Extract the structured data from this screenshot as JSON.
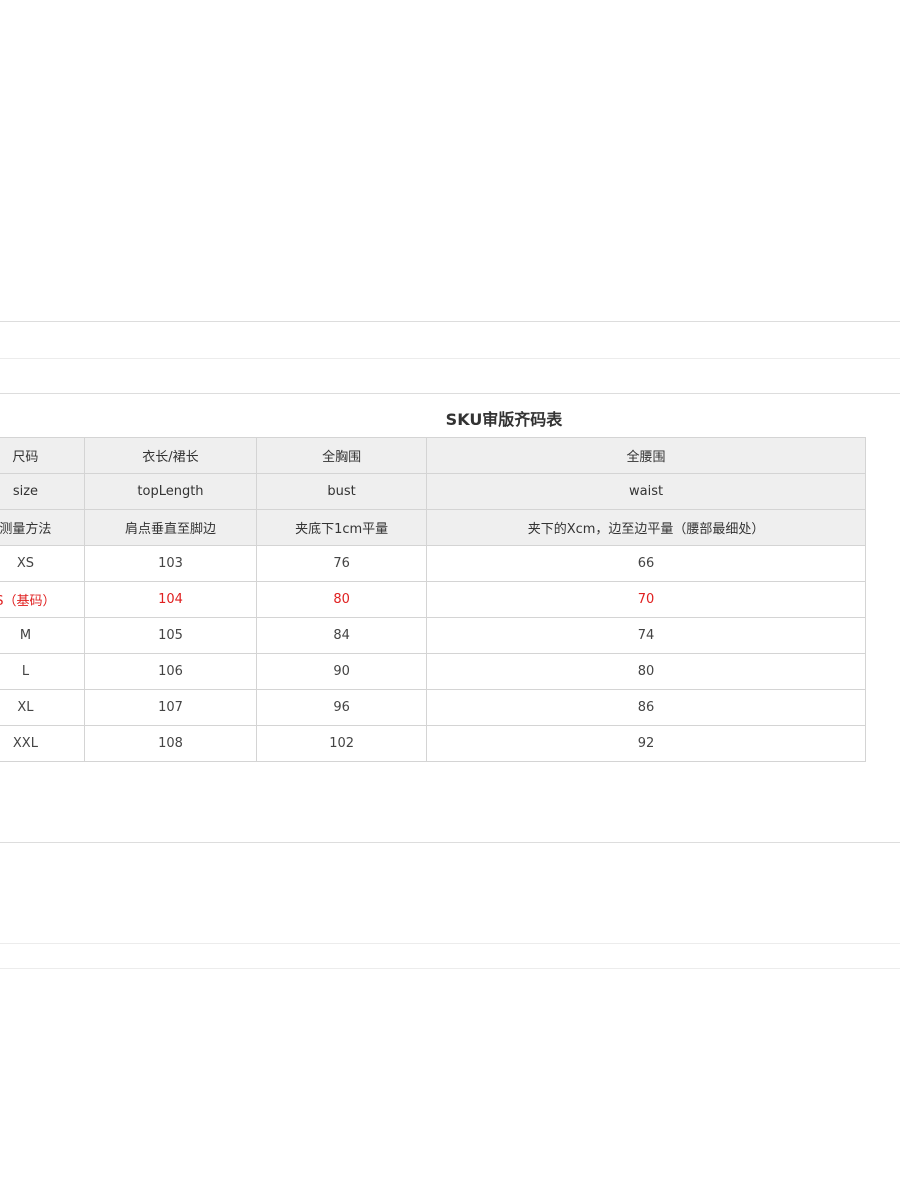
{
  "title": "SKU审版齐码表",
  "header_rows": [
    [
      "尺码",
      "衣长/裙长",
      "全胸围",
      "全腰围"
    ],
    [
      "size",
      "topLength",
      "bust",
      "waist"
    ],
    [
      "测量方法",
      "肩点垂直至脚边",
      "夹底下1cm平量",
      "夹下的Xcm，边至边平量（腰部最细处）"
    ]
  ],
  "rows": [
    [
      "XS",
      "103",
      "76",
      "66"
    ],
    [
      "S（基码）",
      "104",
      "80",
      "70"
    ],
    [
      "M",
      "105",
      "84",
      "74"
    ],
    [
      "L",
      "106",
      "90",
      "80"
    ],
    [
      "XL",
      "107",
      "96",
      "86"
    ],
    [
      "XXL",
      "108",
      "102",
      "92"
    ]
  ],
  "colors": {
    "header_bg": "#efefef",
    "base_size_text": "#e02020",
    "border": "#d4d4d4"
  }
}
